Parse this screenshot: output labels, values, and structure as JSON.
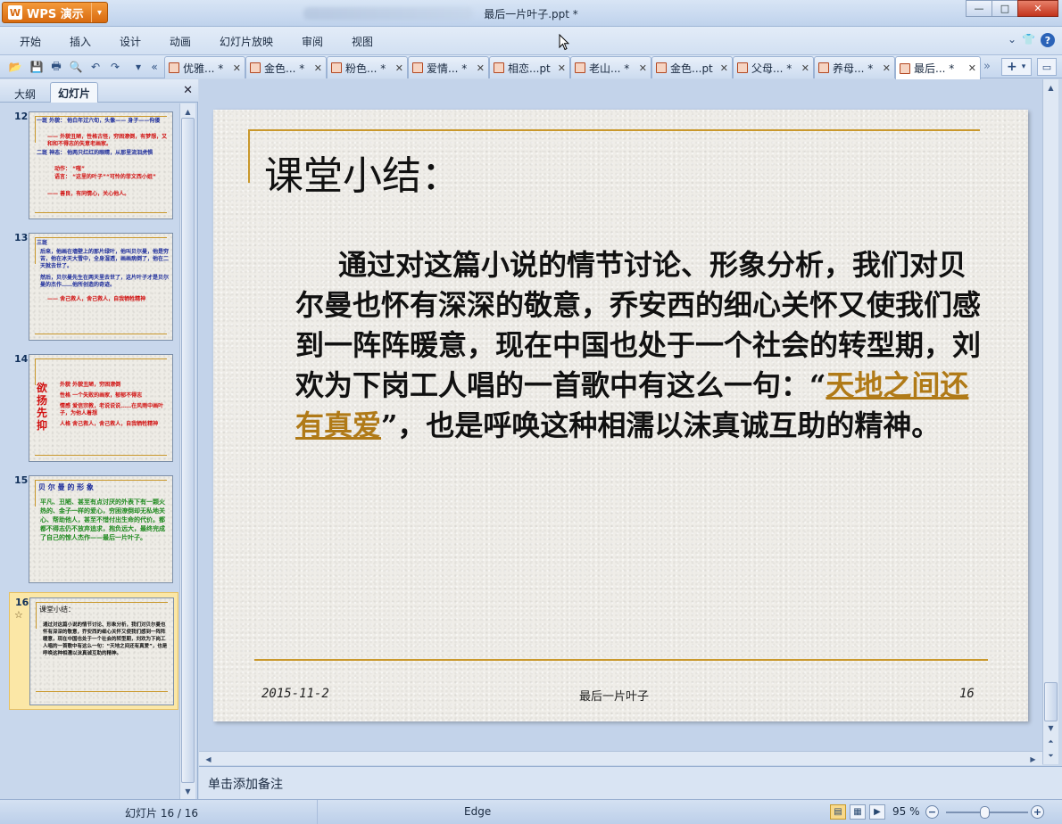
{
  "app": {
    "name": "WPS 演示",
    "logo": "W",
    "window_title": "最后一片叶子.ppt *"
  },
  "window_controls": {
    "minimize": "—",
    "maximize": "□",
    "close": "✕"
  },
  "menu": [
    "开始",
    "插入",
    "设计",
    "动画",
    "幻灯片放映",
    "审阅",
    "视图"
  ],
  "menu_right": {
    "collapse": "⌄",
    "skin": "👕",
    "help": "?"
  },
  "tabs": [
    {
      "label": "优雅... *",
      "active": false
    },
    {
      "label": "金色... *",
      "active": false
    },
    {
      "label": "粉色... *",
      "active": false
    },
    {
      "label": "爱情... *",
      "active": false
    },
    {
      "label": "相恋...pt",
      "active": false
    },
    {
      "label": "老山... *",
      "active": false
    },
    {
      "label": "金色...pt",
      "active": false
    },
    {
      "label": "父母... *",
      "active": false
    },
    {
      "label": "养母... *",
      "active": false
    },
    {
      "label": "最后... *",
      "active": true
    }
  ],
  "left_panel": {
    "tabs": [
      {
        "label": "大纲",
        "active": false
      },
      {
        "label": "幻灯片",
        "active": true
      }
    ],
    "thumbnails": [
      {
        "number": "12",
        "selected": false,
        "lines": [
          {
            "text": "一斑  外貌：  他白年过六旬，头像—— 身子——佝偻",
            "color": "#1a2a9a"
          },
          {
            "text": "—— 外貌丑陋，性格古怪，穷困潦倒，有梦想，又和和不得志的失意老画家。",
            "color": "#d10f0f"
          },
          {
            "text": "二斑  神态：  他两只红红的眼睛，从那里流泪虎惧",
            "color": "#1a2a9a"
          },
          {
            "text": "动作：  “嗤”",
            "color": "#d10f0f"
          },
          {
            "text": "语言：  “这里的叶子”“可怜的菲文西小姐”",
            "color": "#d10f0f"
          },
          {
            "text": "—— 善良，有同情心，关心他人。",
            "color": "#d10f0f"
          }
        ]
      },
      {
        "number": "13",
        "selected": false,
        "lines": [
          {
            "text": "三斑",
            "color": "#1a2a9a"
          },
          {
            "text": "后来，他画在墙壁上的那片绿叶，他叫贝尔曼，他是穷苦，他在冰天大雪中，全身湿透，画画病倒了，他在二天就去世了。",
            "color": "#1a2a9a"
          },
          {
            "text": "然后，贝尔曼先生在两天里去世了，这片叶子才是贝尔曼的杰作……他所创造的奇迹。",
            "color": "#1a2a9a"
          },
          {
            "text": "—— 舍己救人，舍己救人，自我牺牲精神",
            "color": "#d10f0f"
          }
        ]
      },
      {
        "number": "14",
        "selected": false,
        "side": "欲扬先抑",
        "lines": [
          {
            "text": "外貌   外貌丑陋，穷困潦倒",
            "color": "#d10f0f"
          },
          {
            "text": "性格   一个失败的画家，郁郁不得志",
            "color": "#d10f0f"
          },
          {
            "text": "情感   爱信宗教，老说说说……在风雨中画叶子，为他人着想",
            "color": "#d10f0f"
          },
          {
            "text": "人格   舍己救人，舍己救人，自我牺牲精神",
            "color": "#d10f0f"
          }
        ]
      },
      {
        "number": "15",
        "selected": false,
        "title": "贝 尔 曼 的 形 象",
        "lines": [
          {
            "text": "平凡、丑陋、甚至有点讨厌的外表下有一颗火热的、金子一样的爱心，穷困潦倒却无私地关心、帮助他人，甚至不惜付出生命的代价。都都不得志仍不放弃追求，抱负远大，最终完成了自己的惊人杰作——最后一片叶子。",
            "color": "#1f8a1f"
          }
        ]
      },
      {
        "number": "16",
        "selected": true,
        "star": "☆",
        "title": "课堂小结：",
        "lines": [
          {
            "text": "通过对这篇小说的情节讨论、形象分析，我们对贝尔曼也怀有深深的敬意，乔安西的细心关怀又使我们感到一阵阵暖意，现在中国也处于一个社会的转型期，刘欢为下岗工人唱的一首歌中有这么一句：“天地之间还有真爱”，也是呼唤这种相濡以沫真诚互助的精神。",
            "color": "#111111"
          }
        ]
      }
    ]
  },
  "slide": {
    "title": "课堂小结：",
    "paragraph_start": "通过对这篇小说的情节讨论、形象分析，我们对贝尔曼也怀有深深的敬意，乔安西的细心关怀又使我们感到一阵阵暖意，现在中国也处于一个社会的转型期，刘欢为下岗工人唱的一首歌中有这么一句：“",
    "link_text": "天地之间还有真爱",
    "paragraph_end": "”，也是呼唤这种相濡以沫真诚互助的精神。",
    "date": "2015-11-2",
    "footer": "最后一片叶子",
    "number": "16"
  },
  "notes_placeholder": "单击添加备注",
  "status": {
    "slides": "幻灯片 16 / 16",
    "theme": "Edge",
    "zoom": "95 %",
    "zoom_value": 95
  },
  "colors": {
    "accent_gold": "#c9982c",
    "link": "#b07a17",
    "wps_orange": "#e07a20"
  }
}
